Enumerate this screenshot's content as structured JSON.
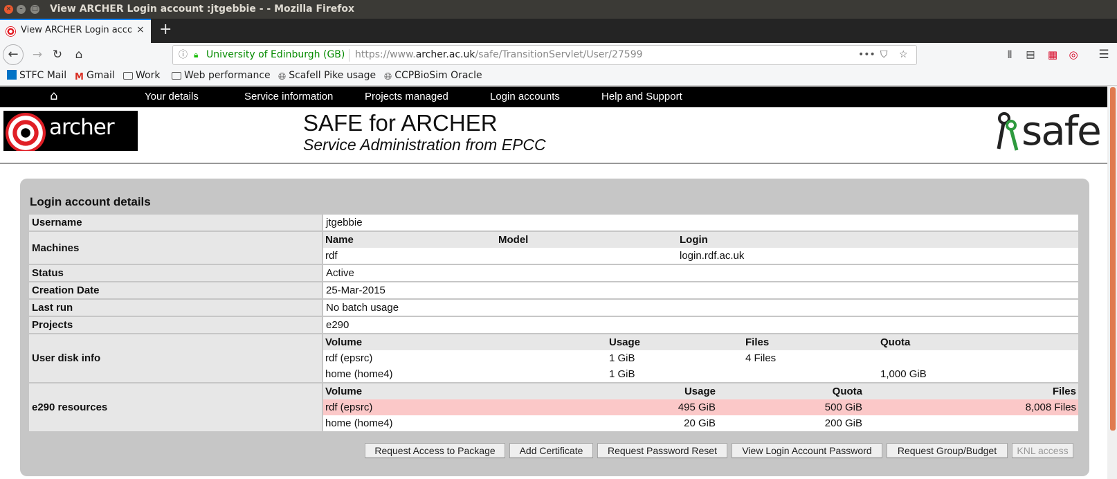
{
  "window": {
    "title": "View ARCHER Login account :jtgebbie -   - Mozilla Firefox"
  },
  "tab": {
    "title": "View ARCHER Login account :jtgebbie -",
    "close": "×",
    "new_tab": "+"
  },
  "nav": {
    "url_org": "University of Edinburgh (GB)",
    "url_prefix": "https://www.",
    "url_domain": "archer.ac.uk",
    "url_path": "/safe/TransitionServlet/User/27599"
  },
  "bookmarks": [
    "STFC Mail",
    "Gmail",
    "Work",
    "Web performance",
    "Scafell Pike usage",
    "CCPBioSim Oracle"
  ],
  "menu": {
    "items": [
      "Your details",
      "Service information",
      "Projects managed",
      "Login accounts",
      "Help and Support"
    ]
  },
  "header": {
    "logo_text": "archer",
    "title": "SAFE for ARCHER",
    "subtitle": "Service Administration from EPCC",
    "safe_logo": "safe"
  },
  "details": {
    "title": "Login account details",
    "username_label": "Username",
    "username": "jtgebbie",
    "machines_label": "Machines",
    "machines_headers": [
      "Name",
      "Model",
      "Login"
    ],
    "machines_rows": [
      [
        "rdf",
        "",
        "login.rdf.ac.uk"
      ]
    ],
    "status_label": "Status",
    "status": "Active",
    "creation_label": "Creation Date",
    "creation": "25-Mar-2015",
    "lastrun_label": "Last run",
    "lastrun": "No batch usage",
    "projects_label": "Projects",
    "projects": "e290",
    "disk_label": "User disk info",
    "disk_headers": [
      "Volume",
      "Usage",
      "Files",
      "Quota"
    ],
    "disk_rows": [
      [
        "rdf (epsrc)",
        "1 GiB",
        "4 Files",
        ""
      ],
      [
        "home (home4)",
        "1 GiB",
        "",
        "1,000 GiB"
      ]
    ],
    "res_label": "e290 resources",
    "res_headers": [
      "Volume",
      "Usage",
      "Quota",
      "Files"
    ],
    "res_rows": [
      [
        "rdf (epsrc)",
        "495 GiB",
        "500 GiB",
        "8,008 Files"
      ],
      [
        "home (home4)",
        "20 GiB",
        "200 GiB",
        ""
      ]
    ]
  },
  "buttons": [
    "Request Access to Package",
    "Add Certificate",
    "Request Password Reset",
    "View Login Account Password",
    "Request Group/Budget",
    "KNL access"
  ],
  "colors": {
    "accent": "#0a84ff",
    "highlight_row": "#fbc8c8",
    "menubar": "#000000",
    "archer_red": "#e01f26"
  }
}
